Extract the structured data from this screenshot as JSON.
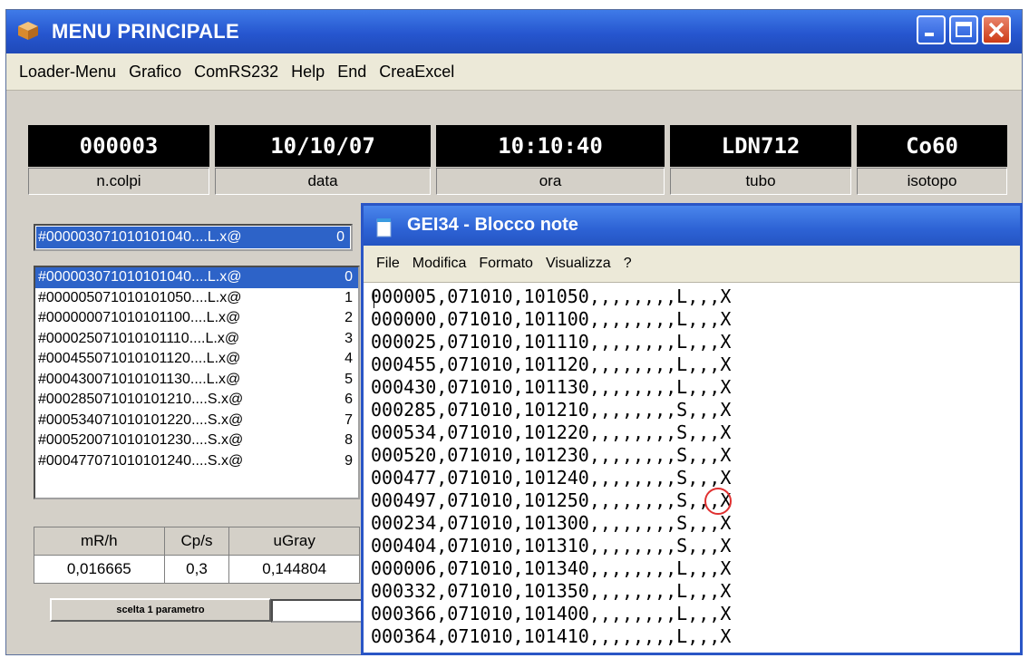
{
  "main_window": {
    "title": "MENU PRINCIPALE",
    "menu": [
      "Loader-Menu",
      "Grafico",
      "ComRS232",
      "Help",
      "End",
      "CreaExcel"
    ],
    "displays": [
      {
        "value": "000003",
        "label": "n.colpi"
      },
      {
        "value": "10/10/07",
        "label": "data"
      },
      {
        "value": "10:10:40",
        "label": "ora"
      },
      {
        "value": "LDN712",
        "label": "tubo"
      },
      {
        "value": "Co60",
        "label": "isotopo"
      }
    ],
    "combo": {
      "value": "#000003071010101040....L.x@",
      "index": "0"
    },
    "list": [
      {
        "text": "#000003071010101040....L.x@",
        "index": "0",
        "selected": true
      },
      {
        "text": "#000005071010101050....L.x@",
        "index": "1"
      },
      {
        "text": "#000000071010101100....L.x@",
        "index": "2"
      },
      {
        "text": "#000025071010101110....L.x@",
        "index": "3"
      },
      {
        "text": "#000455071010101120....L.x@",
        "index": "4"
      },
      {
        "text": "#000430071010101130....L.x@",
        "index": "5"
      },
      {
        "text": "#000285071010101210....S.x@",
        "index": "6"
      },
      {
        "text": "#000534071010101220....S.x@",
        "index": "7"
      },
      {
        "text": "#000520071010101230....S.x@",
        "index": "8"
      },
      {
        "text": "#000477071010101240....S.x@",
        "index": "9"
      }
    ],
    "measures": {
      "headers": [
        "mR/h",
        "Cp/s",
        "uGray"
      ],
      "values": [
        "0,016665",
        "0,3",
        "0,144804"
      ]
    },
    "param_button": "scelta 1 parametro"
  },
  "notepad": {
    "title": "GEI34 - Blocco note",
    "menu": [
      "File",
      "Modifica",
      "Formato",
      "Visualizza",
      "?"
    ],
    "lines": [
      "000005,071010,101050,,,,,,,,L,,,X",
      "000000,071010,101100,,,,,,,,L,,,X",
      "000025,071010,101110,,,,,,,,L,,,X",
      "000455,071010,101120,,,,,,,,L,,,X",
      "000430,071010,101130,,,,,,,,L,,,X",
      "000285,071010,101210,,,,,,,,S,,,X",
      "000534,071010,101220,,,,,,,,S,,,X",
      "000520,071010,101230,,,,,,,,S,,,X",
      "000477,071010,101240,,,,,,,,S,,,X",
      "000497,071010,101250,,,,,,,,S,,,X",
      "000234,071010,101300,,,,,,,,S,,,X",
      "000404,071010,101310,,,,,,,,S,,,X",
      "000006,071010,101340,,,,,,,,L,,,X",
      "000332,071010,101350,,,,,,,,L,,,X",
      "000366,071010,101400,,,,,,,,L,,,X",
      "000364,071010,101410,,,,,,,,L,,,X"
    ]
  },
  "colors": {
    "titlebar": "#2656cf",
    "selection": "#2d63c8",
    "display_bg": "#000000",
    "highlight_circle": "#e03030"
  }
}
